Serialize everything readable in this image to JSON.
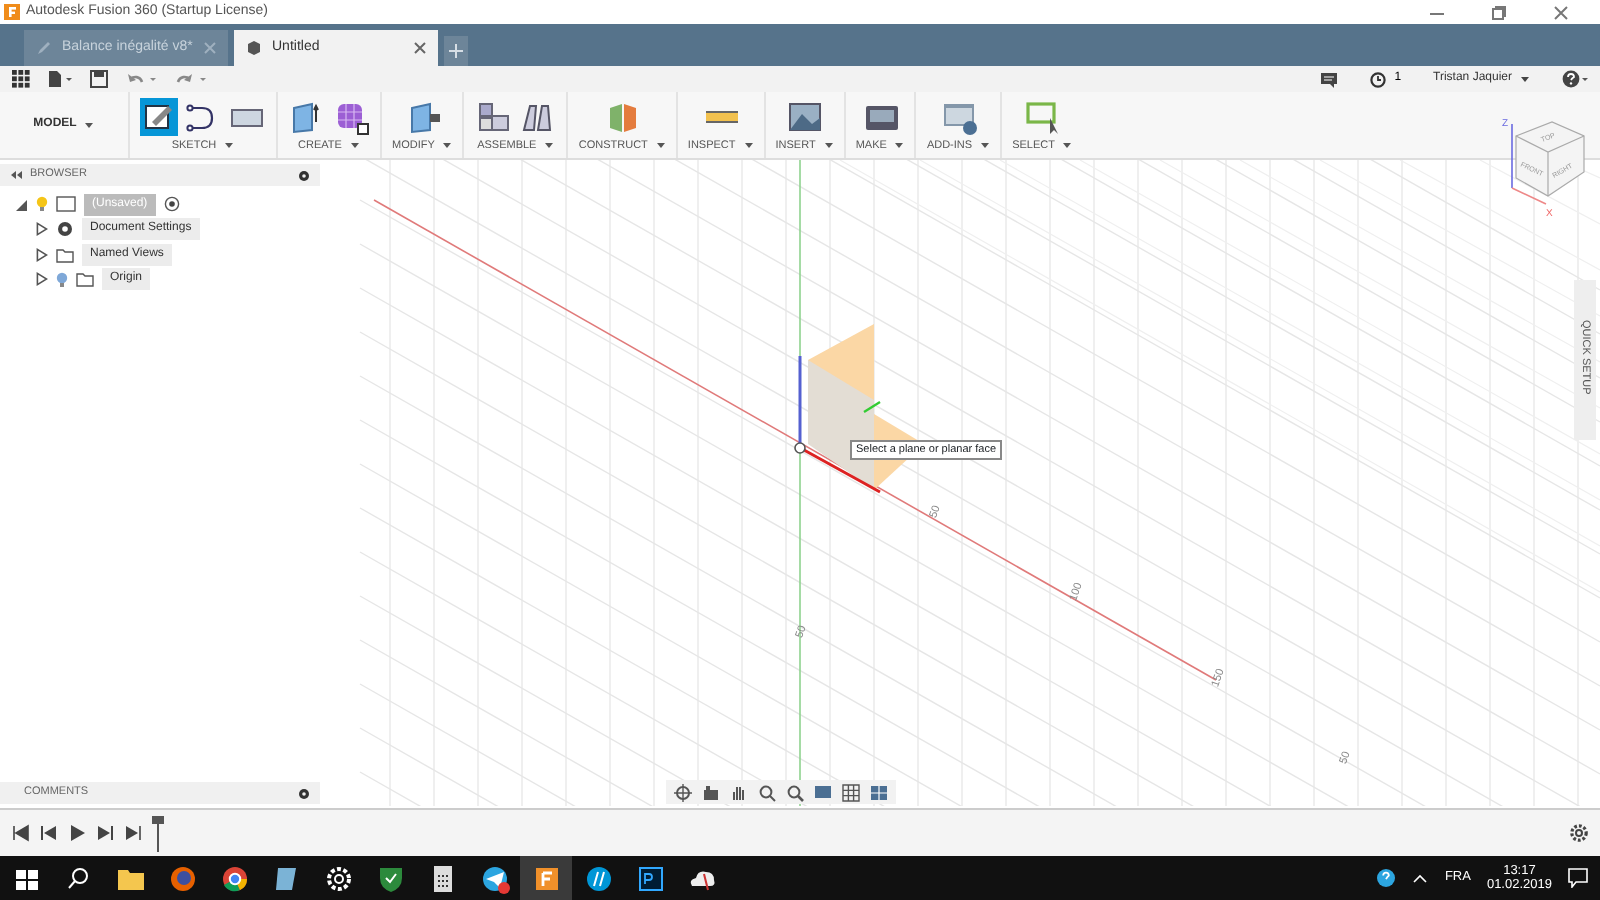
{
  "window": {
    "title": "Autodesk Fusion 360 (Startup License)"
  },
  "tabs": [
    {
      "label": "Balance inégalité v8*",
      "selected": false
    },
    {
      "label": "Untitled",
      "selected": true
    }
  ],
  "quick_bar": {
    "jobs_count": "1",
    "user": "Tristan Jaquier"
  },
  "ribbon": {
    "workspace": "MODEL",
    "groups": [
      {
        "label": "SKETCH",
        "tools": [
          {
            "kind": "sketch",
            "selected": true
          },
          {
            "kind": "arc",
            "selected": false
          },
          {
            "kind": "rect",
            "selected": false
          }
        ]
      },
      {
        "label": "CREATE",
        "tools": [
          {
            "kind": "box",
            "selected": false
          },
          {
            "kind": "mesh",
            "selected": false
          }
        ]
      },
      {
        "label": "MODIFY",
        "tools": [
          {
            "kind": "press",
            "selected": false
          }
        ]
      },
      {
        "label": "ASSEMBLE",
        "tools": [
          {
            "kind": "component",
            "selected": false
          },
          {
            "kind": "joint",
            "selected": false
          }
        ]
      },
      {
        "label": "CONSTRUCT",
        "tools": [
          {
            "kind": "plane",
            "selected": false
          }
        ]
      },
      {
        "label": "INSPECT",
        "tools": [
          {
            "kind": "measure",
            "selected": false
          }
        ]
      },
      {
        "label": "INSERT",
        "tools": [
          {
            "kind": "image",
            "selected": false
          }
        ]
      },
      {
        "label": "MAKE",
        "tools": [
          {
            "kind": "print",
            "selected": false
          }
        ]
      },
      {
        "label": "ADD-INS",
        "tools": [
          {
            "kind": "addin",
            "selected": false
          }
        ]
      },
      {
        "label": "SELECT",
        "tools": [
          {
            "kind": "select",
            "selected": false
          }
        ]
      }
    ]
  },
  "browser": {
    "title": "BROWSER",
    "tree": [
      {
        "label": "(Unsaved)",
        "kind": "root",
        "expanded": true,
        "selected": true,
        "children": [
          {
            "label": "Document Settings",
            "kind": "settings",
            "expanded": false,
            "selected": false
          },
          {
            "label": "Named Views",
            "kind": "folder",
            "expanded": false,
            "selected": false
          },
          {
            "label": "Origin",
            "kind": "origin",
            "expanded": false,
            "selected": false
          }
        ]
      }
    ]
  },
  "viewport": {
    "tooltip": "Select a plane or planar face",
    "axis_labels": [
      {
        "text": "50"
      },
      {
        "text": "100"
      },
      {
        "text": "150"
      },
      {
        "text": "50"
      },
      {
        "text": "50"
      }
    ],
    "viewcube": {
      "top": "TOP",
      "front": "FRONT",
      "right": "RIGHT",
      "z": "Z",
      "x": "X"
    },
    "quick_setup": "QUICK SETUP"
  },
  "comments": {
    "title": "COMMENTS"
  },
  "taskbar": {
    "apps": [
      {
        "kind": "windows",
        "selected": false
      },
      {
        "kind": "search",
        "selected": false
      },
      {
        "kind": "folder",
        "selected": false
      },
      {
        "kind": "firefox",
        "selected": false
      },
      {
        "kind": "chrome",
        "selected": false
      },
      {
        "kind": "notes",
        "selected": false
      },
      {
        "kind": "settings",
        "selected": false
      },
      {
        "kind": "shield",
        "selected": false
      },
      {
        "kind": "calculator",
        "selected": false
      },
      {
        "kind": "telegram",
        "selected": false
      },
      {
        "kind": "fusion",
        "selected": true
      },
      {
        "kind": "hp",
        "selected": false
      },
      {
        "kind": "photoshop",
        "selected": false
      },
      {
        "kind": "cloud",
        "selected": false
      }
    ],
    "language": "FRA",
    "time": "13:17",
    "date": "01.02.2019"
  }
}
